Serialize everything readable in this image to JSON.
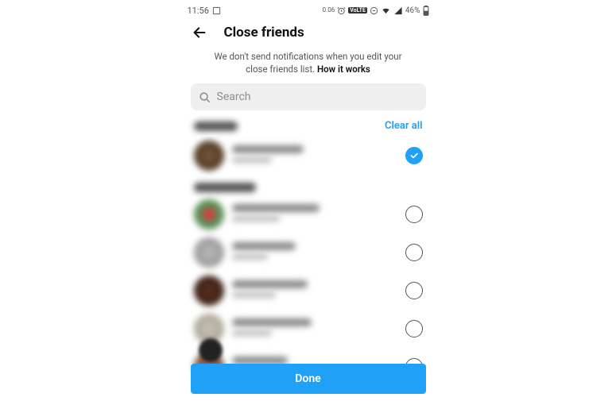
{
  "status": {
    "time": "11:56",
    "data": "0.06",
    "volte": "VoLTE",
    "battery": "46%"
  },
  "header": {
    "title": "Close friends"
  },
  "info": {
    "text": "We don't send notifications when you edit your close friends list.",
    "link": "How it works"
  },
  "search": {
    "placeholder": "Search"
  },
  "actions": {
    "clear_all": "Clear all",
    "done": "Done"
  }
}
